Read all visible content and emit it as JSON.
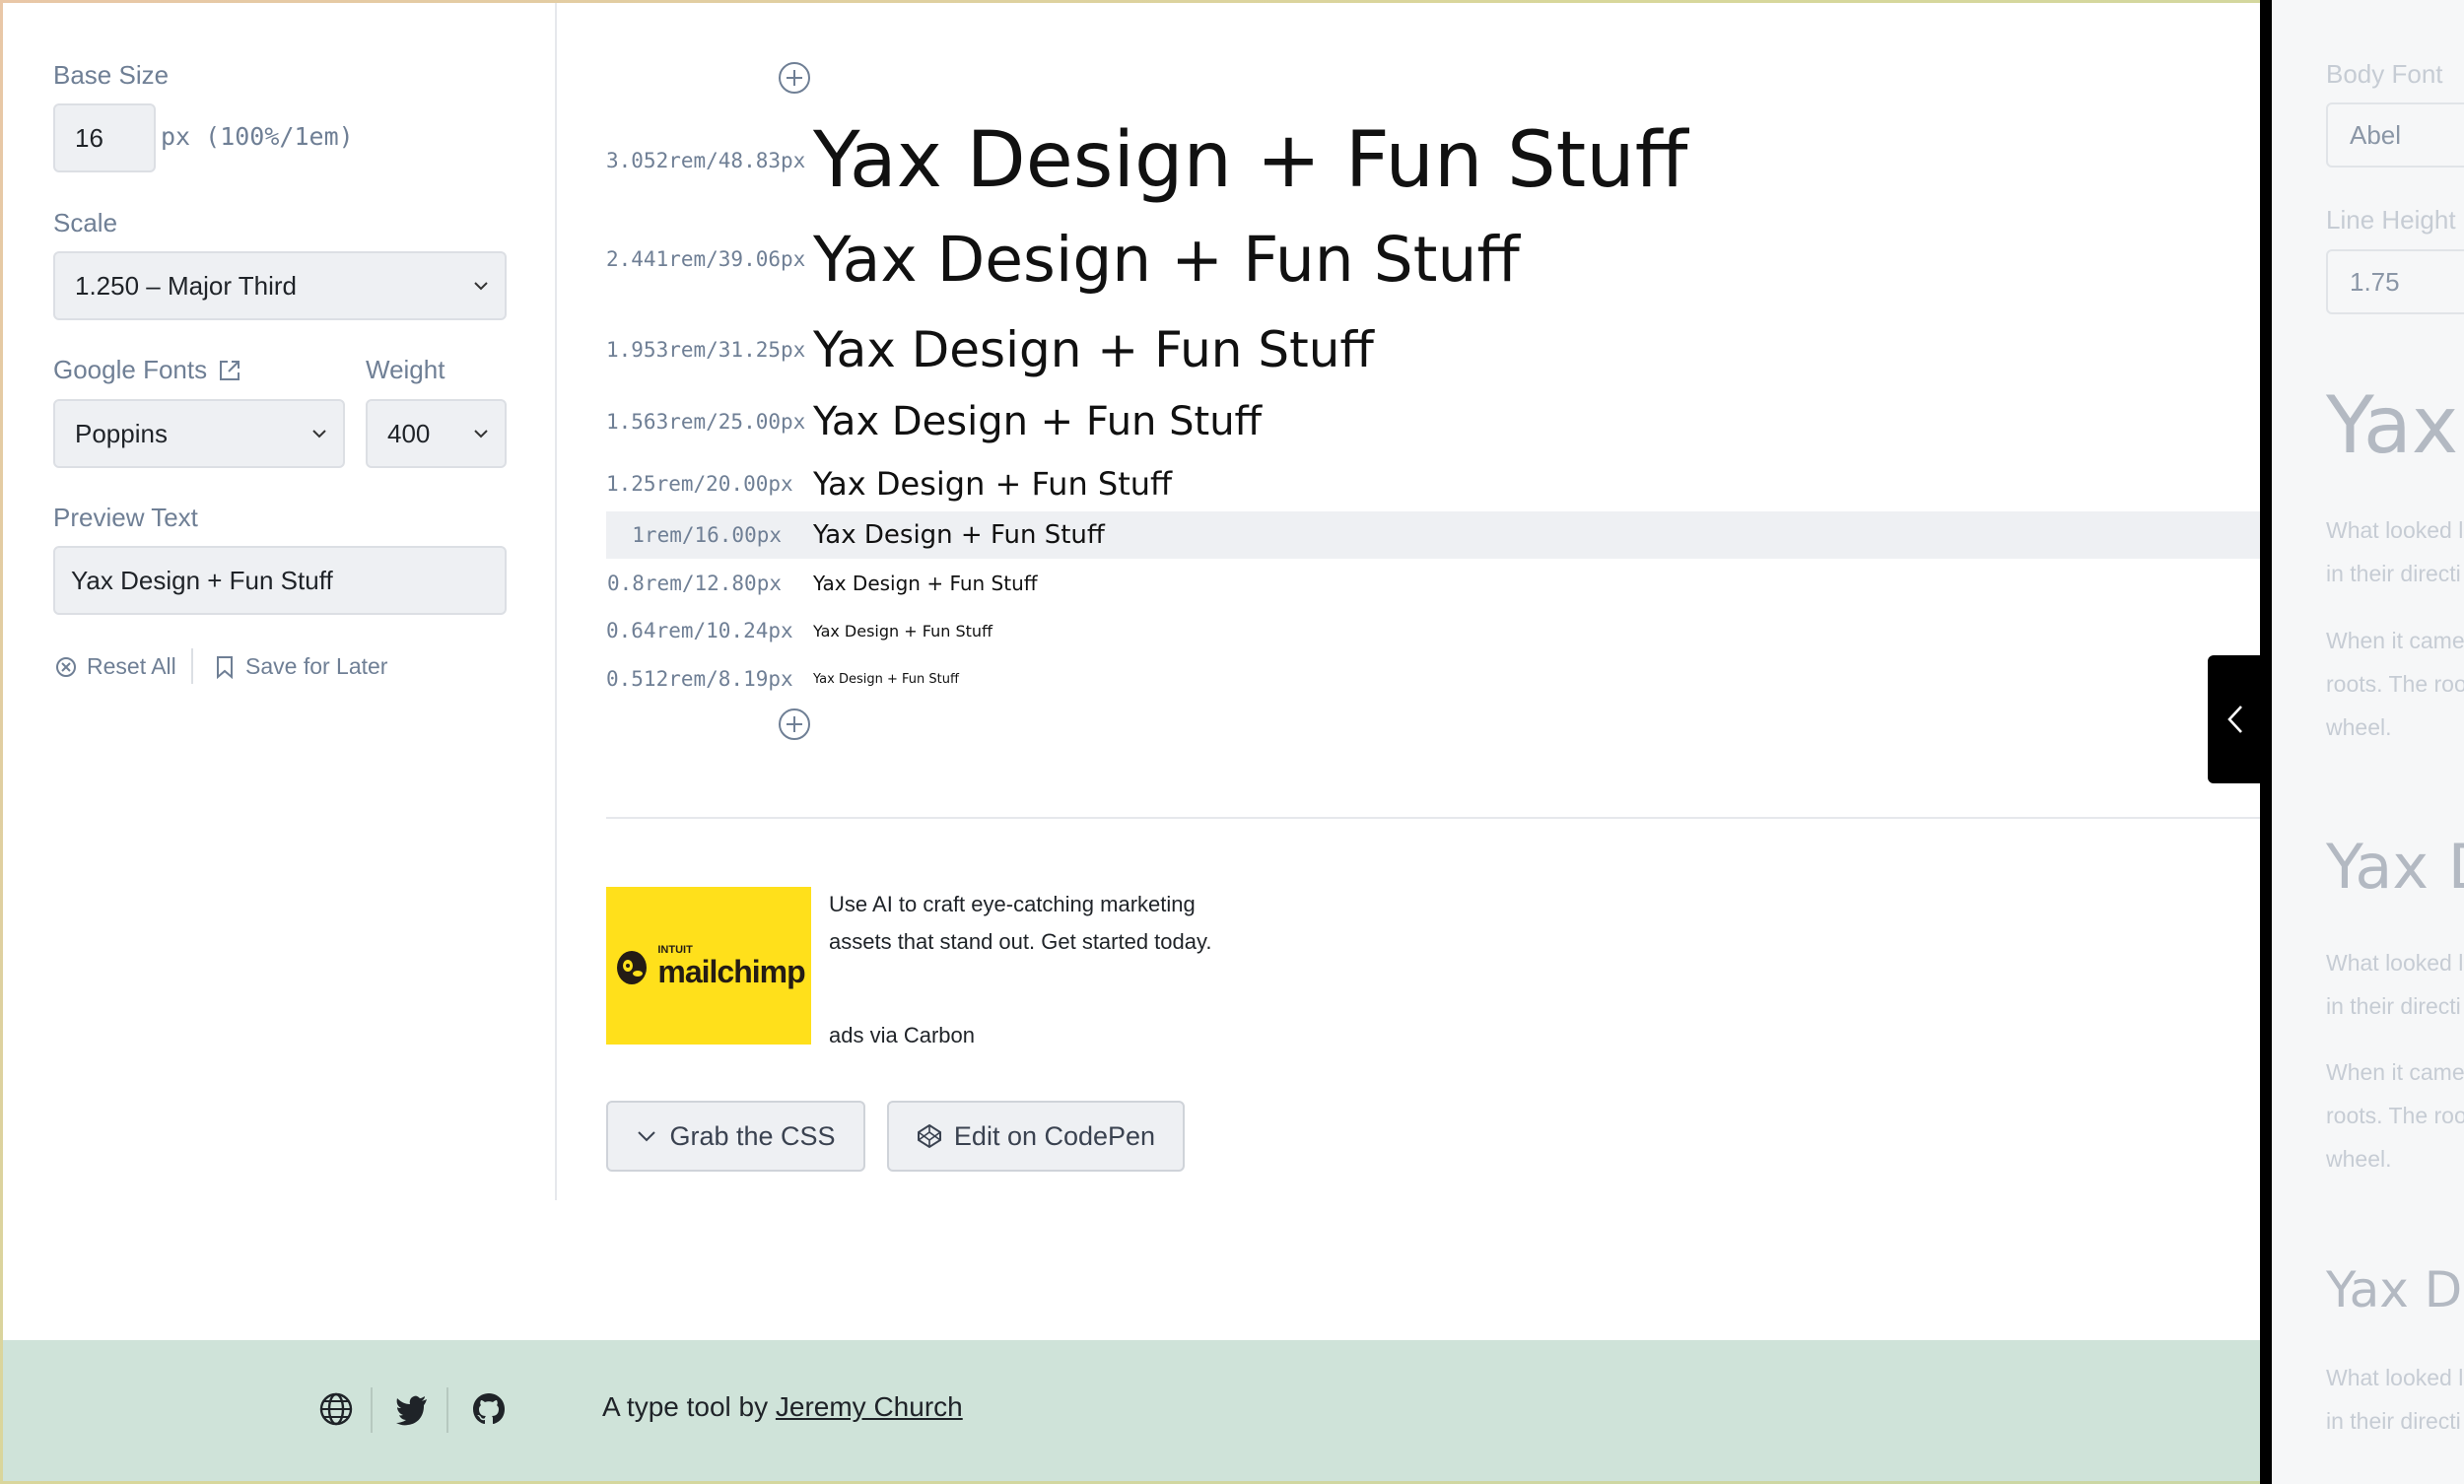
{
  "sidebar": {
    "base_size_label": "Base Size",
    "base_size_value": "16",
    "base_size_unit": "px (100%/1em)",
    "scale_label": "Scale",
    "scale_value": "1.250 – Major Third",
    "fonts_label": "Google Fonts",
    "weight_label": "Weight",
    "font_value": "Poppins",
    "weight_value": "400",
    "preview_label": "Preview Text",
    "preview_value": "Yax Design + Fun Stuff",
    "reset_label": "Reset All",
    "save_label": "Save for Later"
  },
  "scale_rows": [
    {
      "label": "3.052rem/48.83px",
      "sample": "Yax Design + Fun Stuff"
    },
    {
      "label": "2.441rem/39.06px",
      "sample": "Yax Design + Fun Stuff"
    },
    {
      "label": "1.953rem/31.25px",
      "sample": "Yax Design + Fun Stuff"
    },
    {
      "label": "1.563rem/25.00px",
      "sample": "Yax Design + Fun Stuff"
    },
    {
      "label": "1.25rem/20.00px",
      "sample": "Yax Design + Fun Stuff"
    },
    {
      "label": "1rem/16.00px",
      "sample": "Yax Design + Fun Stuff"
    },
    {
      "label": "0.8rem/12.80px",
      "sample": "Yax Design + Fun Stuff"
    },
    {
      "label": "0.64rem/10.24px",
      "sample": "Yax Design + Fun Stuff"
    },
    {
      "label": "0.512rem/8.19px",
      "sample": "Yax Design + Fun Stuff"
    }
  ],
  "ad": {
    "logo_small": "INTUIT",
    "logo_big": "mailchimp",
    "text": "Use AI to craft eye-catching marketing assets that stand out. Get started today.",
    "via": "ads via Carbon"
  },
  "actions": {
    "grab_css": "Grab the CSS",
    "codepen": "Edit on CodePen"
  },
  "footer": {
    "prefix": "A type tool by",
    "author": "Jeremy Church"
  },
  "drawer": {
    "body_font_label": "Body Font",
    "body_font_value": "Abel",
    "line_height_label": "Line Height",
    "line_height_value": "1.75",
    "heading_1": "Yax",
    "para_1a": "What looked li",
    "para_1b": "in their directi",
    "para_2a": "When it came",
    "para_2b": "roots. The root",
    "para_2c": "wheel.",
    "heading_2": "Yax D",
    "para_3a": "What looked li",
    "para_3b": "in their directi",
    "para_4a": "When it came",
    "para_4b": "roots. The root",
    "para_4c": "wheel.",
    "heading_3": "Yax De",
    "para_5a": "What looked li",
    "para_5b": "in their directi"
  },
  "colors": {
    "accent_bg": "#eef0f3",
    "footer_bg": "#cfe3d9",
    "mailchimp_yellow": "#ffe01b"
  }
}
